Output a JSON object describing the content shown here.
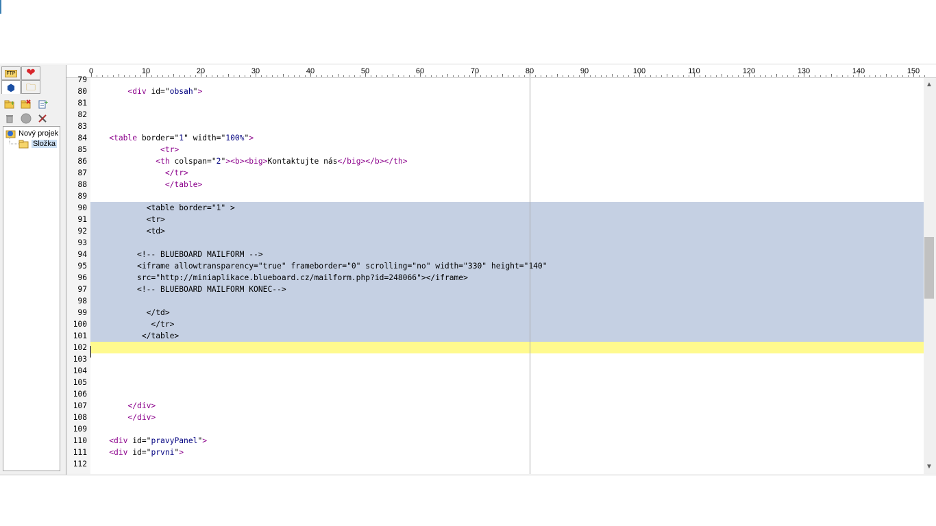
{
  "left_panel": {
    "tabs": {
      "ftp_glyph": "FTP",
      "favorites_glyph": "❤",
      "project_glyph": "⬢",
      "folder_glyph": "🗀"
    },
    "tree": {
      "root": "Nový projek",
      "child": "Složka"
    }
  },
  "ruler": {
    "labels": [
      "0",
      "10",
      "20",
      "30",
      "40",
      "50",
      "60",
      "70",
      "80",
      "90",
      "100",
      "110",
      "120",
      "130",
      "140",
      "150"
    ]
  },
  "editor": {
    "lines": [
      {
        "n": "79",
        "html": ""
      },
      {
        "n": "80",
        "html": "        <span class='tg'>&lt;div</span> id=\"<span class='st'>obsah</span>\"<span class='tg'>&gt;</span>"
      },
      {
        "n": "81",
        "html": ""
      },
      {
        "n": "82",
        "html": ""
      },
      {
        "n": "83",
        "html": ""
      },
      {
        "n": "84",
        "html": "    <span class='tg'>&lt;table</span> border=\"<span class='st'>1</span>\" width=\"<span class='st'>100%</span>\"<span class='tg'>&gt;</span>"
      },
      {
        "n": "85",
        "html": "               <span class='tg'>&lt;tr&gt;</span>"
      },
      {
        "n": "86",
        "html": "              <span class='tg'>&lt;th</span> colspan=\"<span class='st'>2</span>\"<span class='tg'>&gt;&lt;b&gt;&lt;big&gt;</span>Kontaktujte nás<span class='tg'>&lt;/big&gt;&lt;/b&gt;&lt;/th&gt;</span>"
      },
      {
        "n": "87",
        "html": "                <span class='tg'>&lt;/tr&gt;</span>"
      },
      {
        "n": "88",
        "html": "                <span class='tg'>&lt;/table&gt;</span>"
      },
      {
        "n": "89",
        "html": ""
      },
      {
        "n": "90",
        "html": "            &lt;table border=\"1\" &gt;",
        "sel": true
      },
      {
        "n": "91",
        "html": "            &lt;tr&gt;",
        "sel": true
      },
      {
        "n": "92",
        "html": "            &lt;td&gt;",
        "sel": true
      },
      {
        "n": "93",
        "html": "",
        "sel": true
      },
      {
        "n": "94",
        "html": "          &lt;!-- BLUEBOARD MAILFORM --&gt;",
        "sel": true
      },
      {
        "n": "95",
        "html": "          &lt;iframe allowtransparency=\"true\" frameborder=\"0\" scrolling=\"no\" width=\"330\" height=\"140\"",
        "sel": true
      },
      {
        "n": "96",
        "html": "          src=\"http://miniaplikace.blueboard.cz/mailform.php?id=248066\"&gt;&lt;/iframe&gt;",
        "sel": true
      },
      {
        "n": "97",
        "html": "          &lt;!-- BLUEBOARD MAILFORM KONEC--&gt;",
        "sel": true
      },
      {
        "n": "98",
        "html": "",
        "sel": true
      },
      {
        "n": "99",
        "html": "            &lt;/td&gt;",
        "sel": true
      },
      {
        "n": "100",
        "html": "             &lt;/tr&gt;",
        "sel": true
      },
      {
        "n": "101",
        "html": "           &lt;/table&gt;",
        "sel": true
      },
      {
        "n": "102",
        "html": "",
        "cur": true
      },
      {
        "n": "103",
        "html": ""
      },
      {
        "n": "104",
        "html": ""
      },
      {
        "n": "105",
        "html": ""
      },
      {
        "n": "106",
        "html": ""
      },
      {
        "n": "107",
        "html": "        <span class='tg'>&lt;/div&gt;</span>"
      },
      {
        "n": "108",
        "html": "        <span class='tg'>&lt;/div&gt;</span>"
      },
      {
        "n": "109",
        "html": ""
      },
      {
        "n": "110",
        "html": "    <span class='tg'>&lt;div</span> id=\"<span class='st'>pravyPanel</span>\"<span class='tg'>&gt;</span>"
      },
      {
        "n": "111",
        "html": "    <span class='tg'>&lt;div</span> id=\"<span class='st'>prvni</span>\"<span class='tg'>&gt;</span>"
      },
      {
        "n": "112",
        "html": ""
      }
    ]
  },
  "colors": {
    "selection": "#c5d0e3",
    "current_line": "#fffa8e",
    "tag": "#8b008b",
    "string": "#000080"
  },
  "icons": {
    "scroll_up": "▲",
    "scroll_down": "▼"
  }
}
